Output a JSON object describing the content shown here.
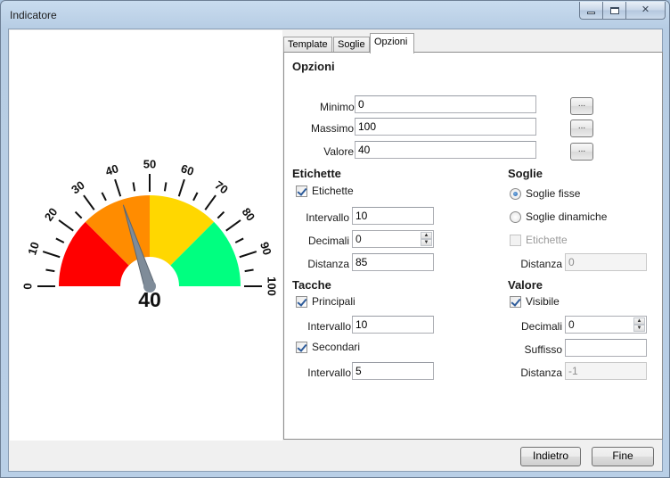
{
  "window": {
    "title": "Indicatore"
  },
  "gauge": {
    "value": 40,
    "value_text": "40",
    "min": 0,
    "max": 100,
    "label_interval": 10,
    "tick_labels": [
      "0",
      "10",
      "20",
      "30",
      "40",
      "50",
      "60",
      "70",
      "80",
      "90",
      "100"
    ],
    "band_colors": [
      "#ff0000",
      "#ff8c00",
      "#ffd700",
      "#00ff80"
    ]
  },
  "tabs": [
    "Template",
    "Soglie",
    "Opzioni"
  ],
  "panel": {
    "title": "Opzioni",
    "minimo": {
      "label": "Minimo",
      "value": "0"
    },
    "massimo": {
      "label": "Massimo",
      "value": "100"
    },
    "valore": {
      "label": "Valore",
      "value": "40"
    },
    "dots_label": "...",
    "etichette": {
      "header": "Etichette",
      "checkbox_label": "Etichette",
      "intervallo_label": "Intervallo",
      "intervallo_value": "10",
      "decimali_label": "Decimali",
      "decimali_value": "0",
      "distanza_label": "Distanza",
      "distanza_value": "85"
    },
    "soglie": {
      "header": "Soglie",
      "fisse_label": "Soglie fisse",
      "dinamiche_label": "Soglie dinamiche",
      "etichette_label": "Etichette",
      "distanza_label": "Distanza",
      "distanza_value": "0"
    },
    "tacche": {
      "header": "Tacche",
      "principali_label": "Principali",
      "intervallo1_label": "Intervallo",
      "intervallo1_value": "10",
      "secondari_label": "Secondari",
      "intervallo2_label": "Intervallo",
      "intervallo2_value": "5"
    },
    "valore_section": {
      "header": "Valore",
      "visibile_label": "Visibile",
      "decimali_label": "Decimali",
      "decimali_value": "0",
      "suffisso_label": "Suffisso",
      "suffisso_value": "",
      "distanza_label": "Distanza",
      "distanza_value": "-1"
    }
  },
  "buttons": {
    "back": "Indietro",
    "finish": "Fine"
  }
}
